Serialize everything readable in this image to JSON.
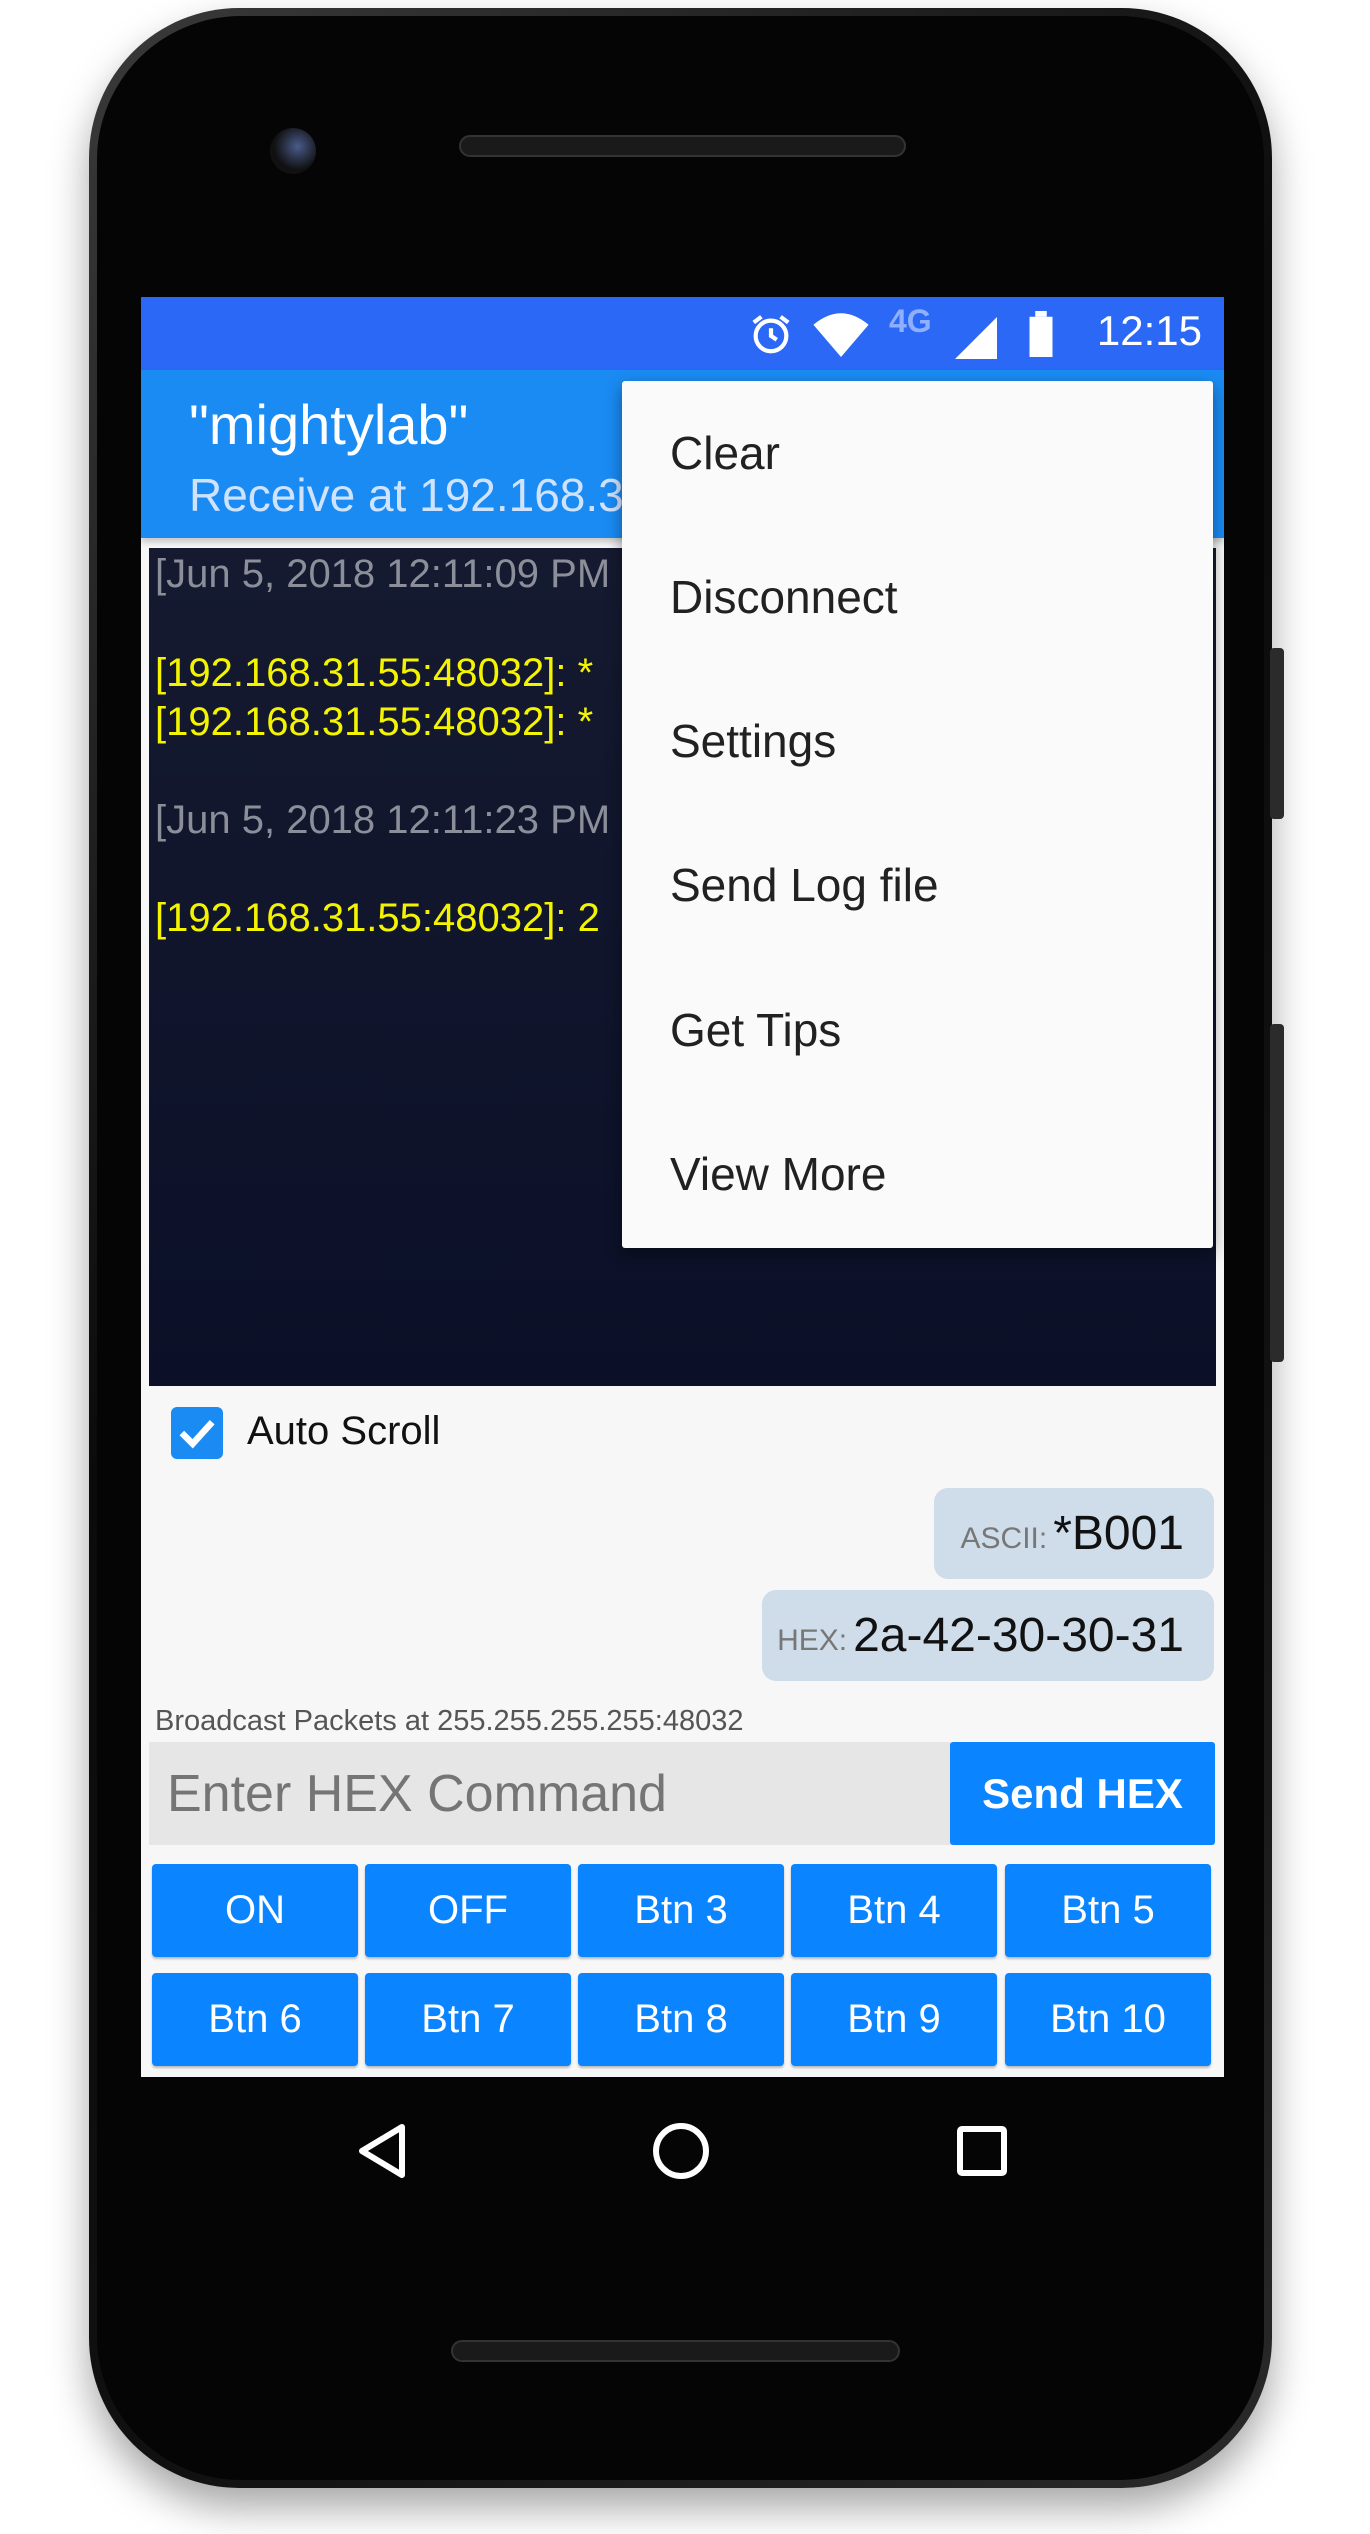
{
  "status_bar": {
    "time": "12:15",
    "network": "4G",
    "icons": [
      "alarm-icon",
      "wifi-icon",
      "signal-icon",
      "battery-icon"
    ]
  },
  "app_bar": {
    "title": "\"mightylab\"",
    "subtitle": "Receive at 192.168.3"
  },
  "log": [
    {
      "text": "[Jun 5, 2018 12:11:09 PM",
      "type": "timestamp"
    },
    {
      "text": "[192.168.31.55:48032]: *",
      "type": "packet"
    },
    {
      "text": "[192.168.31.55:48032]: *",
      "type": "packet"
    },
    {
      "text": "[Jun 5, 2018 12:11:23 PM",
      "type": "timestamp"
    },
    {
      "text": "[192.168.31.55:48032]: 2",
      "type": "packet"
    }
  ],
  "menu": {
    "items": [
      "Clear",
      "Disconnect",
      "Settings",
      "Send Log file",
      "Get Tips",
      "View More"
    ]
  },
  "auto_scroll": {
    "label": "Auto Scroll",
    "checked": true
  },
  "sent": {
    "ascii_label": "ASCII:",
    "ascii_value": "*B001",
    "hex_label": "HEX:",
    "hex_value": "2a-42-30-30-31"
  },
  "broadcast": "Broadcast Packets at 255.255.255.255:48032",
  "command": {
    "placeholder": "Enter HEX Command",
    "value": "",
    "send_label": "Send HEX"
  },
  "buttons": [
    "ON",
    "OFF",
    "Btn 3",
    "Btn 4",
    "Btn 5",
    "Btn 6",
    "Btn 7",
    "Btn 8",
    "Btn 9",
    "Btn 10"
  ],
  "colors": {
    "accent": "#0b84ff",
    "status_bar": "#2a68f5",
    "app_bar": "#1a8bf3",
    "log_bg": "#0b1028",
    "packet_text": "#f4f400"
  }
}
